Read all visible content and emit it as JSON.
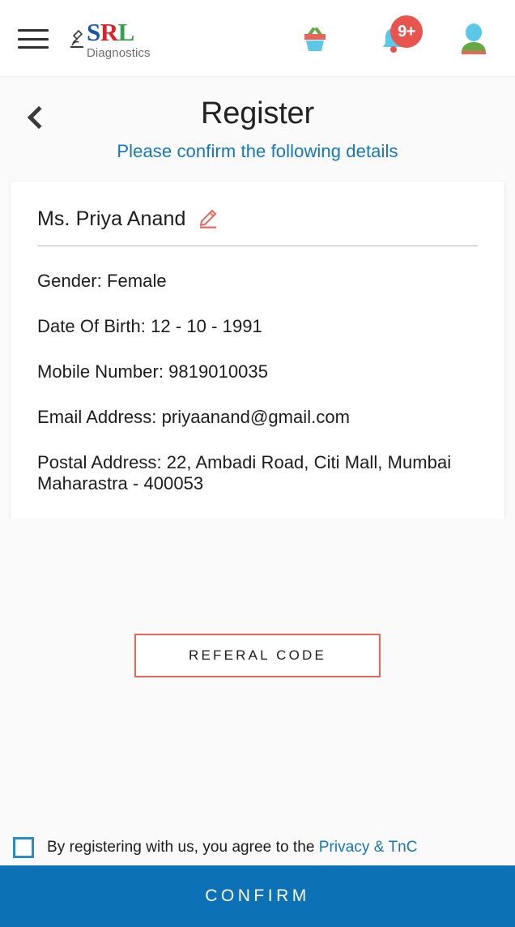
{
  "appbar": {
    "menu_icon": "hamburger-menu-icon",
    "brand": {
      "logo_icon": "microscope-icon",
      "letter_s": "S",
      "letter_r": "R",
      "letter_l": "L",
      "subtitle": "Diagnostics",
      "color_s": "#1a56a8",
      "color_r": "#d8232a",
      "color_l": "#34a04a"
    },
    "actions": [
      {
        "name": "cart-icon",
        "label": "Cart"
      },
      {
        "name": "notifications-bell-icon",
        "label": "Notifications",
        "badge": "9+",
        "badge_color": "#e8554e"
      },
      {
        "name": "profile-avatar-icon",
        "label": "Profile"
      }
    ]
  },
  "page": {
    "back_icon": "chevron-left-icon",
    "title": "Register",
    "subtitle": "Please confirm the following details",
    "subtitle_color": "#1577bc"
  },
  "card": {
    "name": "Ms. Priya Anand",
    "edit_icon": "edit-pencil-icon",
    "edit_icon_color": "#e8665c",
    "details": [
      "Gender: Female",
      "Date Of Birth: 12 - 10 - 1991",
      "Mobile Number: 9819010035",
      "Email Address: priyaanand@gmail.com",
      "Postal Address: 22, Ambadi Road, Citi Mall, Mumbai Maharastra - 400053"
    ]
  },
  "referral": {
    "label": "REFERAL CODE",
    "border_color": "#e8665c"
  },
  "consent": {
    "checked": false,
    "text": "By registering with us, you agree to the ",
    "link_text": "Privacy & TnC",
    "link_color": "#1577bc",
    "checkbox_color": "#2b8cc8"
  },
  "confirm": {
    "label": "CONFIRM",
    "background": "#0d72b5"
  }
}
